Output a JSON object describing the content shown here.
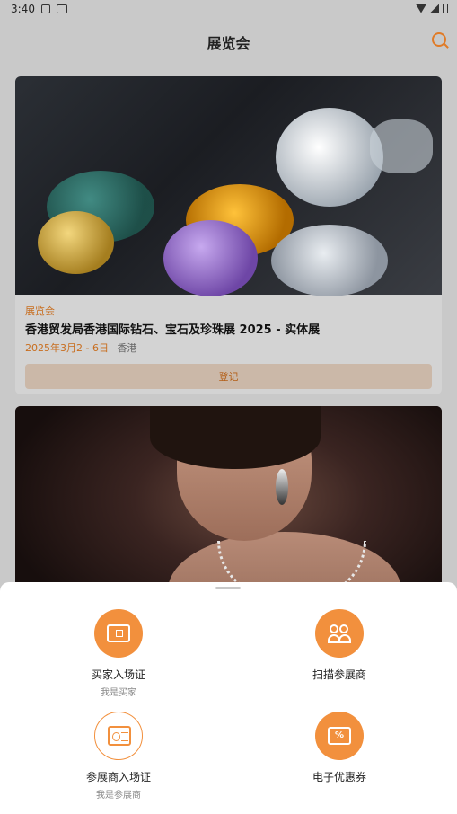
{
  "status_bar": {
    "time": "3:40"
  },
  "header": {
    "title": "展览会"
  },
  "events": [
    {
      "tag": "展览会",
      "title": "香港贸发局香港国际钻石、宝石及珍珠展 2025 - 实体展",
      "date": "2025年3月2 - 6日",
      "location": "香港",
      "button_label": "登记"
    }
  ],
  "actions": [
    {
      "label": "买家入场证",
      "sub": "我是买家",
      "icon": "ticket-qr-icon"
    },
    {
      "label": "扫描参展商",
      "sub": "",
      "icon": "people-icon"
    },
    {
      "label": "参展商入场证",
      "sub": "我是参展商",
      "icon": "badge-icon"
    },
    {
      "label": "电子优惠券",
      "sub": "",
      "icon": "coupon-icon"
    }
  ],
  "colors": {
    "accent": "#f2903d",
    "tag_text": "#c86d1e"
  }
}
